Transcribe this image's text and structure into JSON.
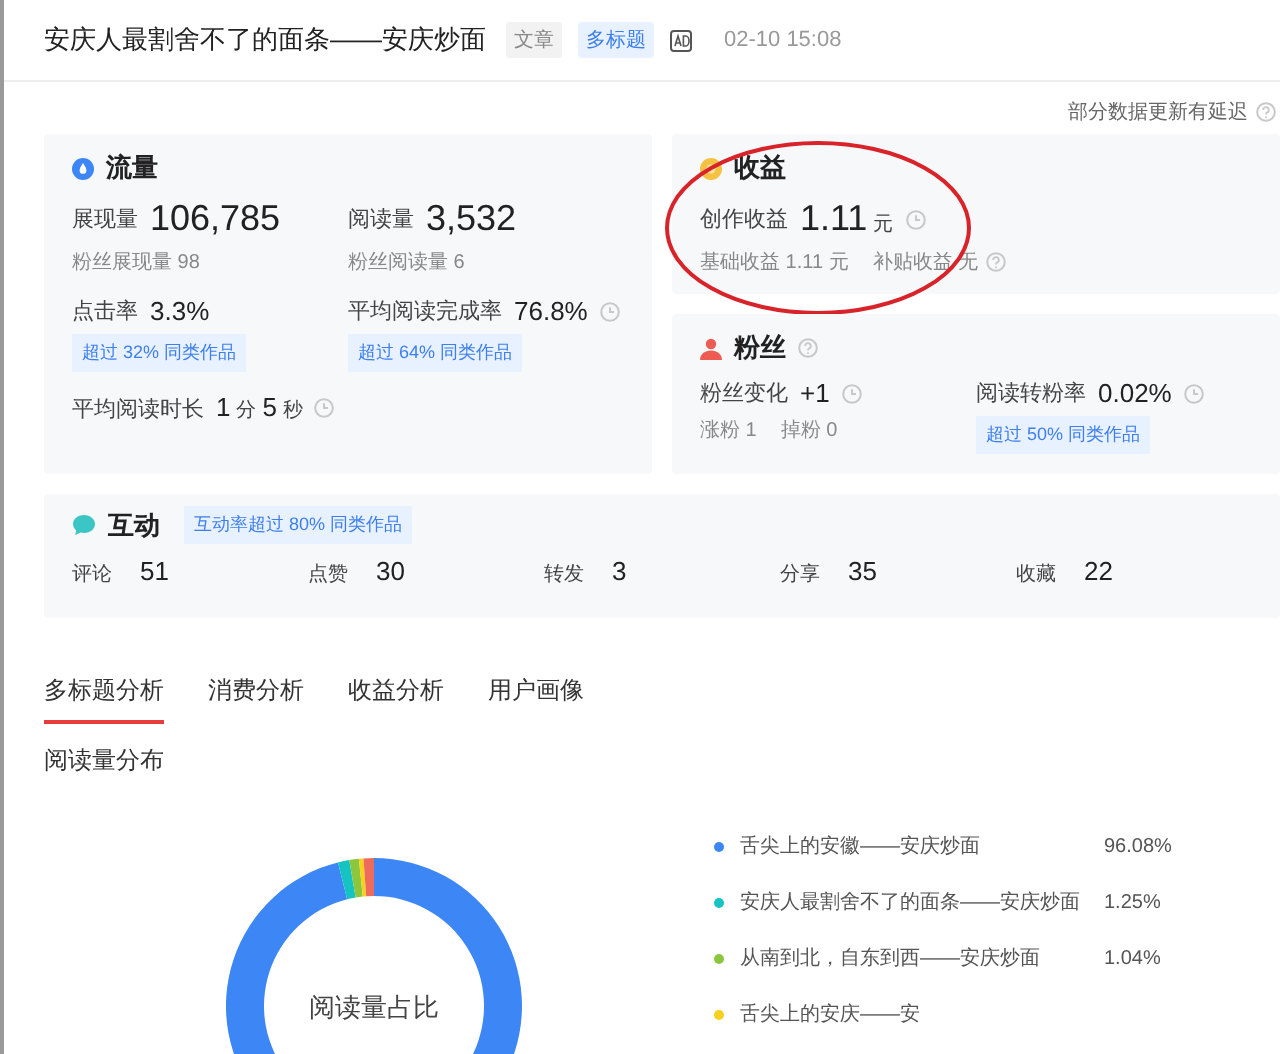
{
  "header": {
    "title": "安庆人最割舍不了的面条——安庆炒面",
    "tags": [
      {
        "label": "文章",
        "kind": "plain"
      },
      {
        "label": "多标题",
        "kind": "blue"
      }
    ],
    "time": "02-10 15:08"
  },
  "notice": {
    "text": "部分数据更新有延迟",
    "help": true
  },
  "traffic": {
    "title": "流量",
    "metrics": [
      {
        "label": "展现量",
        "kind": "large",
        "value": [
          {
            "text": "106,785",
            "kind": "number"
          }
        ],
        "clock": false,
        "subs": [
          {
            "label": "粉丝展现量",
            "value": "98"
          }
        ]
      },
      {
        "label": "阅读量",
        "kind": "large",
        "value": [
          {
            "text": "3,532",
            "kind": "number"
          }
        ],
        "clock": false,
        "subs": [
          {
            "label": "粉丝阅读量",
            "value": "6"
          }
        ]
      },
      {
        "label": "点击率",
        "kind": "normal",
        "value": [
          {
            "text": "3.3%",
            "kind": "number"
          }
        ],
        "clock": false,
        "badge": "超过 32% 同类作品"
      },
      {
        "label": "平均阅读完成率",
        "kind": "normal",
        "value": [
          {
            "text": "76.8%",
            "kind": "number"
          }
        ],
        "clock": true,
        "badge": "超过 64% 同类作品"
      },
      {
        "label": "平均阅读时长",
        "kind": "normal",
        "value": [
          {
            "text": "1",
            "kind": "number"
          },
          {
            "text": "分",
            "kind": "unit"
          },
          {
            "text": "5",
            "kind": "number"
          },
          {
            "text": "秒",
            "kind": "unit"
          }
        ],
        "clock": true
      }
    ]
  },
  "revenue": {
    "title": "收益",
    "circled": true,
    "metrics": [
      {
        "label": "创作收益",
        "kind": "large",
        "value": [
          {
            "text": "1.11",
            "kind": "number"
          },
          {
            "text": "元",
            "kind": "unit"
          }
        ],
        "clock": true,
        "subs": [
          {
            "label": "基础收益",
            "value": "1.11 元",
            "help": false
          },
          {
            "label": "补贴收益",
            "value": "无",
            "help": true
          }
        ]
      }
    ]
  },
  "fans": {
    "title": "粉丝",
    "help": true,
    "metrics": [
      {
        "label": "粉丝变化",
        "kind": "normal",
        "value": [
          {
            "text": "+1",
            "kind": "number"
          }
        ],
        "clock": true,
        "subs": [
          {
            "label": "涨粉",
            "value": "1"
          },
          {
            "label": "掉粉",
            "value": "0"
          }
        ]
      },
      {
        "label": "阅读转粉率",
        "kind": "normal",
        "value": [
          {
            "text": "0.02%",
            "kind": "number"
          }
        ],
        "clock": true,
        "badge": "超过 50% 同类作品"
      }
    ]
  },
  "interaction": {
    "title": "互动",
    "badge": "互动率超过 80% 同类作品",
    "stats": [
      {
        "label": "评论",
        "value": "51"
      },
      {
        "label": "点赞",
        "value": "30"
      },
      {
        "label": "转发",
        "value": "3"
      },
      {
        "label": "分享",
        "value": "35"
      },
      {
        "label": "收藏",
        "value": "22"
      }
    ]
  },
  "tabs": [
    {
      "label": "多标题分析",
      "selected": true
    },
    {
      "label": "消费分析",
      "selected": false
    },
    {
      "label": "收益分析",
      "selected": false
    },
    {
      "label": "用户画像",
      "selected": false
    }
  ],
  "section_title": "阅读量分布",
  "donut": {
    "center_label": "阅读量占比",
    "legend": [
      {
        "name": "舌尖上的安徽——安庆炒面",
        "percent": "96.08%",
        "color": "#3d86f5"
      },
      {
        "name": "安庆人最割舍不了的面条——安庆炒面",
        "percent": "1.25%",
        "color": "#16c3c3"
      },
      {
        "name": "从南到北，自东到西——安庆炒面",
        "percent": "1.04%",
        "color": "#8cc63e"
      },
      {
        "name": "舌尖上的安庆——安",
        "color": "#f7d11c"
      }
    ]
  }
}
